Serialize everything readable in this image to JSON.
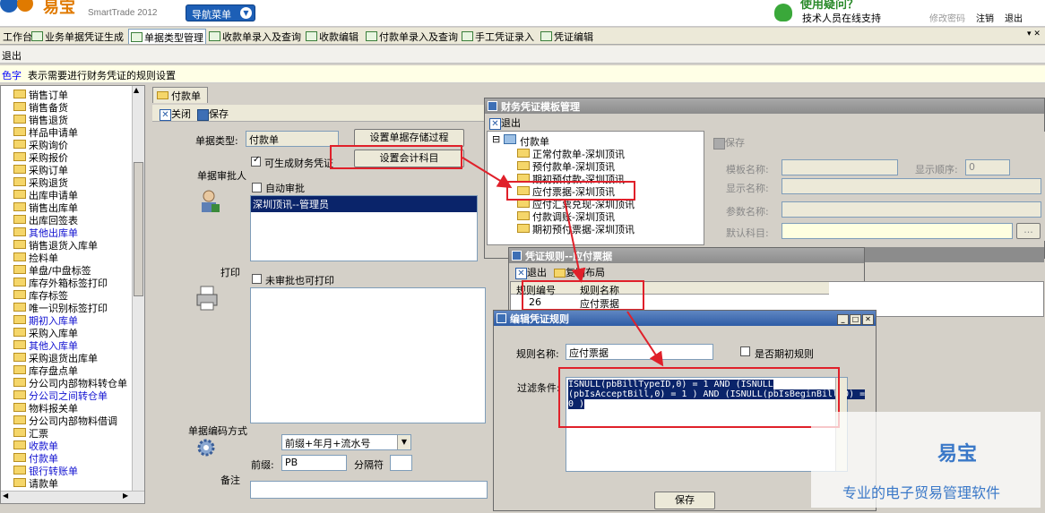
{
  "app": {
    "brand": "易宝",
    "subtitle": "SmartTrade 2012",
    "nav_menu": "导航菜单",
    "support_top": "使用疑问？",
    "support": "技术人员在线支持",
    "change_password": "修改密码",
    "logout": "注销",
    "exit": "退出"
  },
  "tabs": [
    {
      "label": "工作台"
    },
    {
      "label": "业务单据凭证生成"
    },
    {
      "label": "单据类型管理"
    },
    {
      "label": "收款单录入及查询"
    },
    {
      "label": "收款编辑"
    },
    {
      "label": "付款单录入及查询"
    },
    {
      "label": "手工凭证录入"
    },
    {
      "label": "凭证编辑"
    }
  ],
  "toolbar": {
    "exit": "退出"
  },
  "info": {
    "key": "色字",
    "text": "表示需要进行财务凭证的规则设置"
  },
  "tree": [
    {
      "label": "销售订单",
      "blue": false
    },
    {
      "label": "销售备货",
      "blue": false
    },
    {
      "label": "销售退货",
      "blue": false
    },
    {
      "label": "样品申请单",
      "blue": false
    },
    {
      "label": "采购询价",
      "blue": false
    },
    {
      "label": "采购报价",
      "blue": false
    },
    {
      "label": "采购订单",
      "blue": false
    },
    {
      "label": "采购退货",
      "blue": false
    },
    {
      "label": "出库申请单",
      "blue": false
    },
    {
      "label": "销售出库单",
      "blue": false
    },
    {
      "label": "出库回签表",
      "blue": false
    },
    {
      "label": "其他出库单",
      "blue": true
    },
    {
      "label": "销售退货入库单",
      "blue": false
    },
    {
      "label": "捡料单",
      "blue": false
    },
    {
      "label": "单盘/中盘标签",
      "blue": false
    },
    {
      "label": "库存外箱标签打印",
      "blue": false
    },
    {
      "label": "库存标签",
      "blue": false
    },
    {
      "label": "唯一识别标签打印",
      "blue": false
    },
    {
      "label": "期初入库单",
      "blue": true
    },
    {
      "label": "采购入库单",
      "blue": false
    },
    {
      "label": "其他入库单",
      "blue": true
    },
    {
      "label": "采购退货出库单",
      "blue": false
    },
    {
      "label": "库存盘点单",
      "blue": false
    },
    {
      "label": "分公司内部物料转仓单",
      "blue": false
    },
    {
      "label": "分公司之间转仓单",
      "blue": true
    },
    {
      "label": "物料报关单",
      "blue": false
    },
    {
      "label": "分公司内部物料借调",
      "blue": false
    },
    {
      "label": "汇票",
      "blue": false
    },
    {
      "label": "收款单",
      "blue": true
    },
    {
      "label": "付款单",
      "blue": true
    },
    {
      "label": "银行转账单",
      "blue": true
    },
    {
      "label": "请款单",
      "blue": false
    }
  ],
  "billform": {
    "tab": "付款单",
    "close": "关闭",
    "save": "保存",
    "type_label": "单据类型:",
    "type_value": "付款单",
    "set_storage_btn": "设置单据存储过程",
    "set_account_btn": "设置会计科目",
    "can_voucher": "可生成财务凭证",
    "approver_label": "单据审批人",
    "auto_approve": "自动审批",
    "approver_value": "深圳顶讯--管理员",
    "print_label": "打印",
    "print_unapproved": "未审批也可打印",
    "code_label": "单据编码方式",
    "code_value": "前缀+年月+流水号",
    "prefix_label": "前缀:",
    "prefix_value": "PB",
    "sep_label": "分隔符",
    "remark_label": "备注"
  },
  "template_win": {
    "title": "财务凭证模板管理",
    "exit": "退出",
    "root": "付款单",
    "items": [
      "正常付款单-深圳顶讯",
      "预付款单-深圳顶讯",
      "期初预付款-深圳顶讯",
      "应付票据-深圳顶讯",
      "应付汇票兑现-深圳顶讯",
      "付款调账-深圳顶讯",
      "期初预付票据-深圳顶讯"
    ],
    "save": "保存",
    "f_name": "模板名称:",
    "f_order": "显示顺序:",
    "f_order_value": "0",
    "f_display": "显示名称:",
    "f_param": "参数名称:",
    "f_default": "默认科目:"
  },
  "rule_win": {
    "title": "凭证规则--应付票据",
    "exit": "退出",
    "copy_layout": "复制布局",
    "col_id": "规则编号",
    "col_name": "规则名称",
    "row_id": "26",
    "row_name": "应付票据"
  },
  "edit_win": {
    "title": "编辑凭证规则",
    "name_label": "规则名称:",
    "name_value": "应付票据",
    "is_initial": "是否期初规则",
    "filter_label": "过滤条件:",
    "filter_line1": "ISNULL(pbBillTypeID,0) = 1 AND (ISNULL",
    "filter_line2": "(pbIsAcceptBill,0) = 1 ) AND (ISNULL(pbIsBeginBill,0) =",
    "filter_line3": "0 )",
    "save": "保存"
  },
  "watermark": {
    "brand": "易宝",
    "slogan": "专业的电子贸易管理软件"
  },
  "colors": {
    "accent": "#1d5fb6",
    "highlight": "#e0202a",
    "selection": "#0a246a"
  }
}
